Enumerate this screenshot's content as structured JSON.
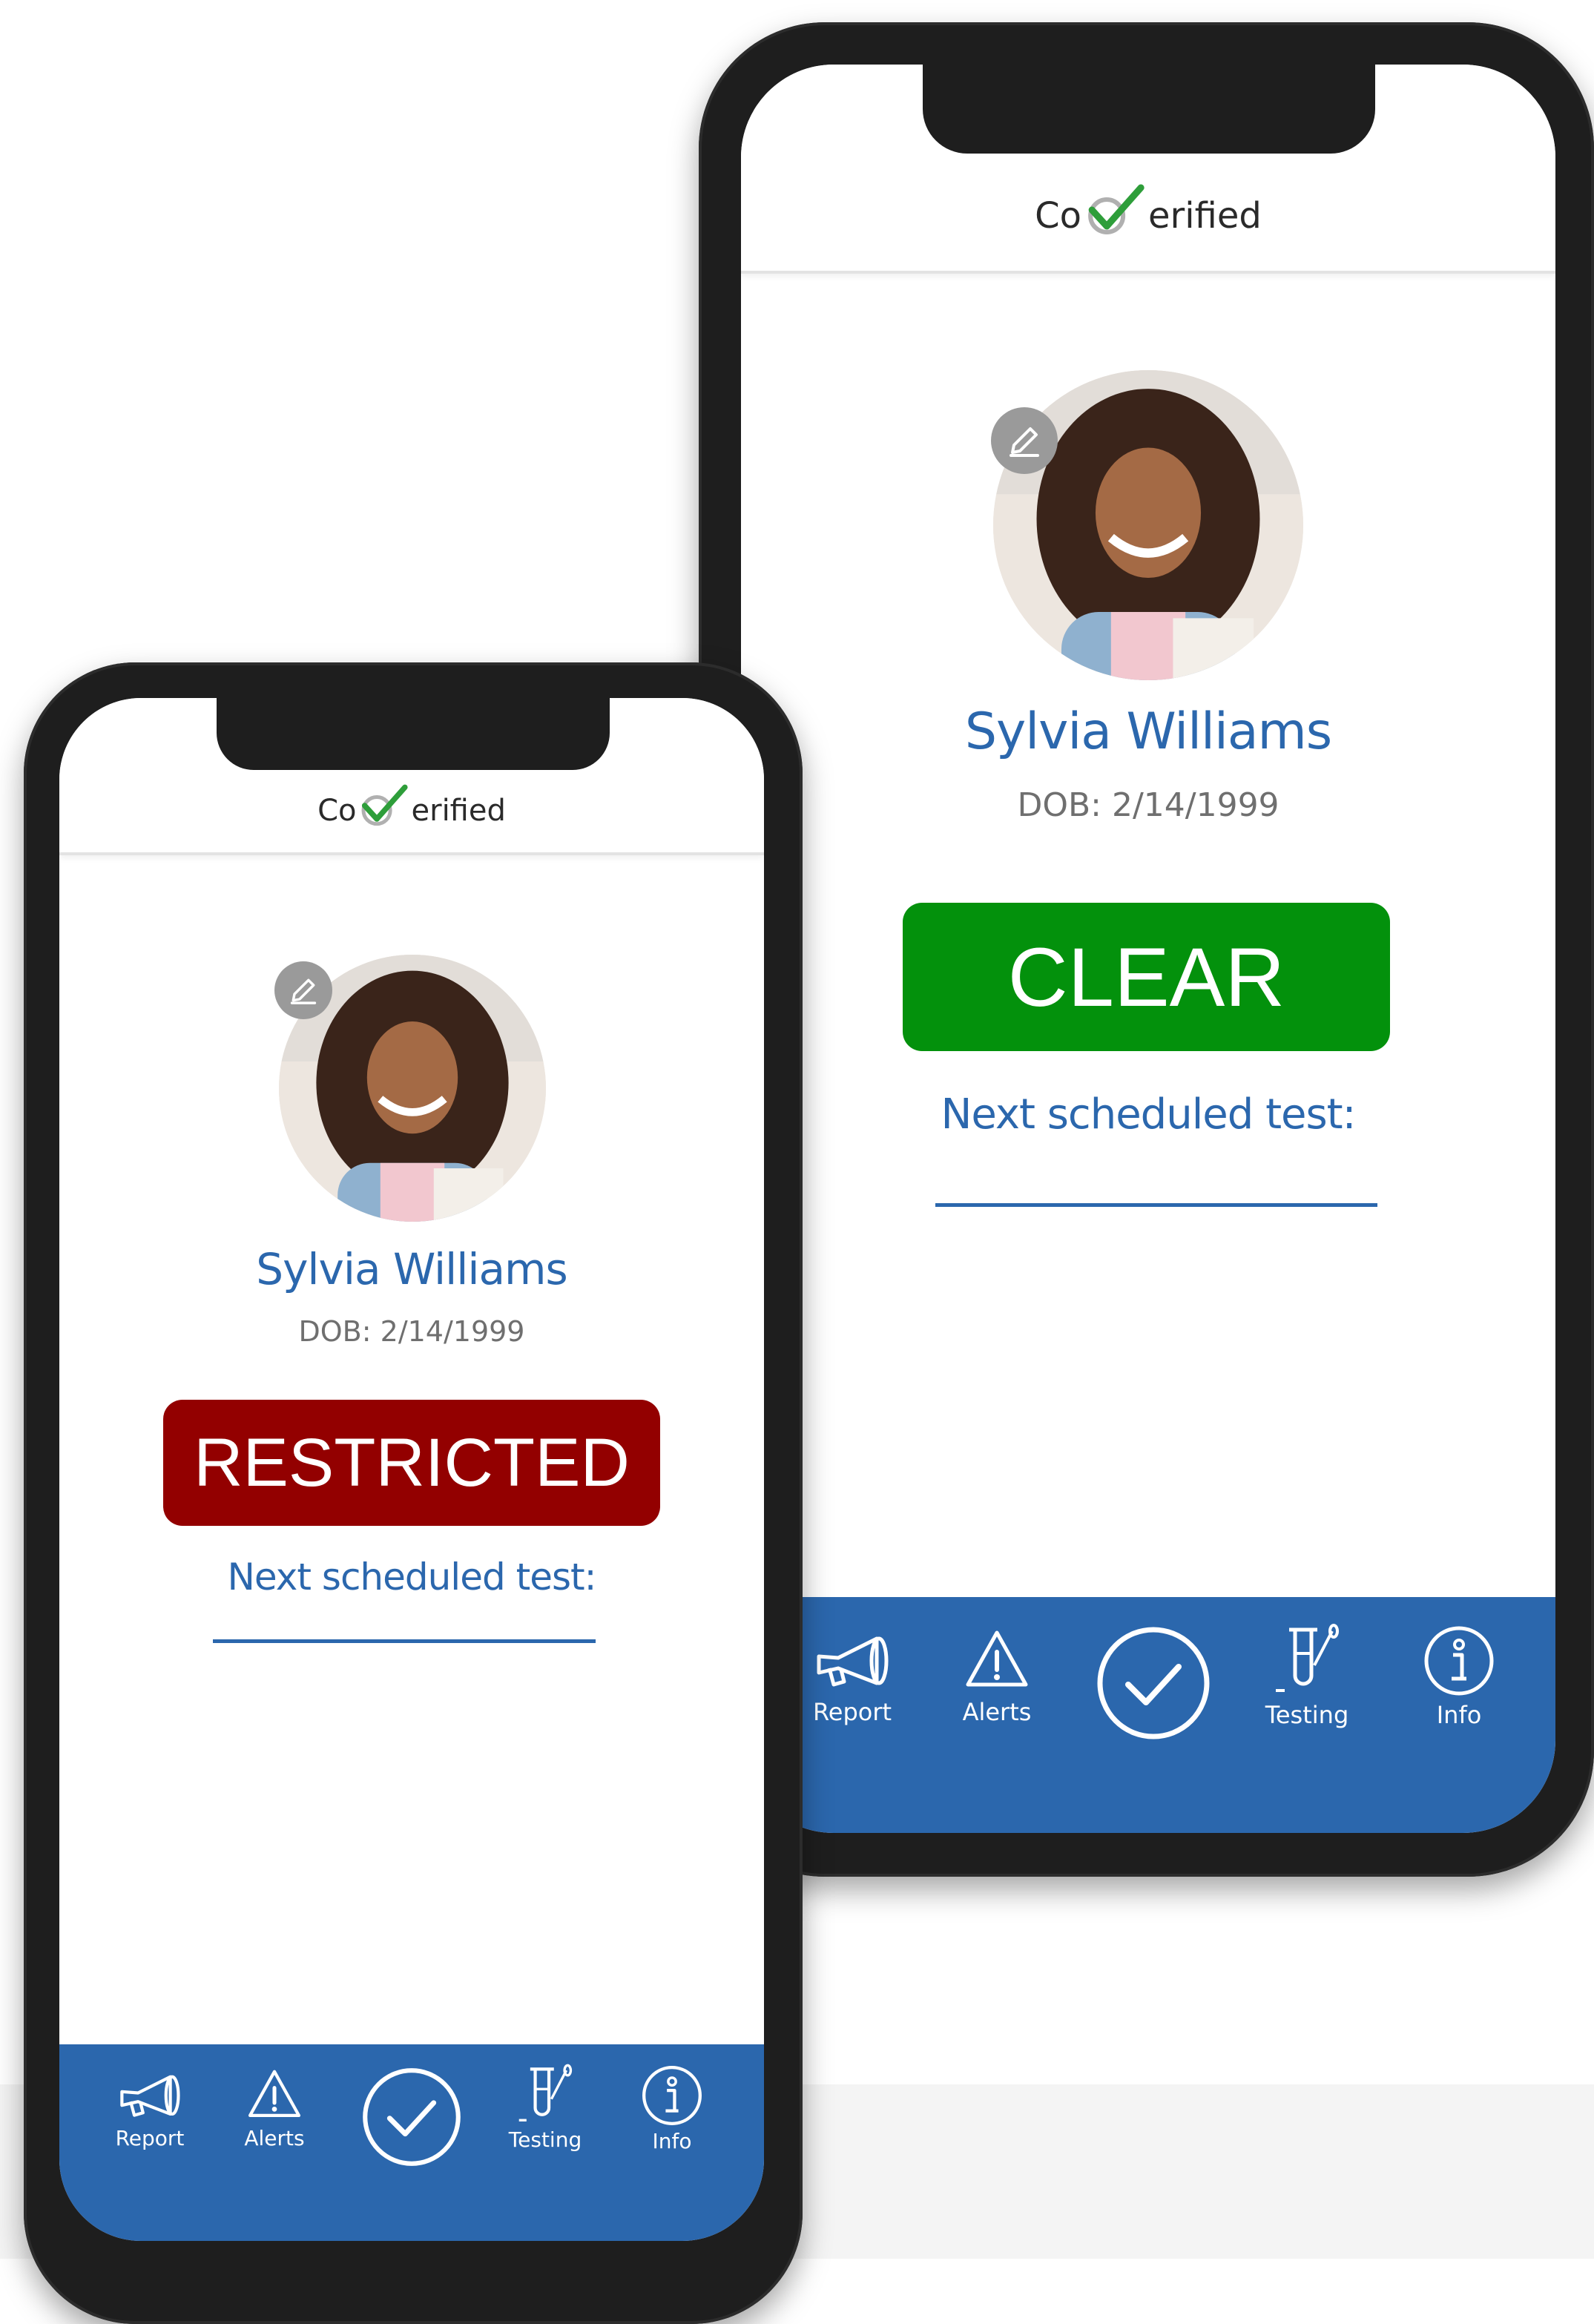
{
  "brand": {
    "logo_prefix": "Co",
    "logo_suffix": "erified",
    "check_color": "#2e9e3a",
    "ring_color": "#b0b0b0"
  },
  "colors": {
    "primary_blue": "#2b67ad",
    "clear_green": "#03910c",
    "restricted_red": "#930000"
  },
  "front_phone": {
    "profile": {
      "name": "Sylvia Williams",
      "dob": "DOB: 2/14/1999",
      "edit_icon": "pencil-icon"
    },
    "status_label": "RESTRICTED",
    "next_test_label": "Next scheduled test:",
    "next_test_value": ""
  },
  "back_phone": {
    "profile": {
      "name": "Sylvia Williams",
      "dob": "DOB: 2/14/1999",
      "edit_icon": "pencil-icon"
    },
    "status_label": "CLEAR",
    "next_test_label": "Next scheduled test:",
    "next_test_value": ""
  },
  "nav": {
    "items": [
      {
        "label": "Report",
        "icon": "megaphone-icon"
      },
      {
        "label": "Alerts",
        "icon": "warning-icon"
      },
      {
        "label": "",
        "icon": "check-circle-icon"
      },
      {
        "label": "Testing",
        "icon": "test-tube-icon"
      },
      {
        "label": "Info",
        "icon": "info-icon"
      }
    ]
  }
}
